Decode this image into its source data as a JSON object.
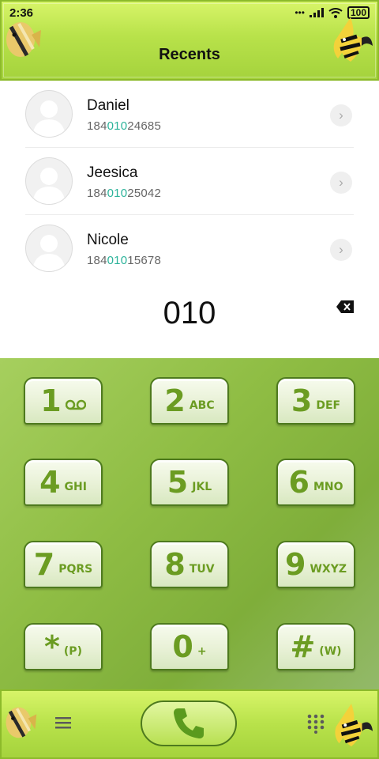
{
  "status": {
    "time": "2:36",
    "battery": "100"
  },
  "header": {
    "title": "Recents"
  },
  "contacts": [
    {
      "name": "Daniel",
      "number_prefix": "184",
      "number_match": "010",
      "number_suffix": "24685"
    },
    {
      "name": "Jeesica",
      "number_prefix": "184",
      "number_match": "010",
      "number_suffix": "25042"
    },
    {
      "name": "Nicole",
      "number_prefix": "184",
      "number_match": "010",
      "number_suffix": "15678"
    }
  ],
  "dialer": {
    "entry": "010"
  },
  "keys": [
    {
      "digit": "1",
      "letters": ""
    },
    {
      "digit": "2",
      "letters": "ABC"
    },
    {
      "digit": "3",
      "letters": "DEF"
    },
    {
      "digit": "4",
      "letters": "GHI"
    },
    {
      "digit": "5",
      "letters": "JKL"
    },
    {
      "digit": "6",
      "letters": "MNO"
    },
    {
      "digit": "7",
      "letters": "PQRS"
    },
    {
      "digit": "8",
      "letters": "TUV"
    },
    {
      "digit": "9",
      "letters": "WXYZ"
    },
    {
      "digit": "*",
      "letters": "(P)"
    },
    {
      "digit": "0",
      "letters": "+"
    },
    {
      "digit": "#",
      "letters": "(W)"
    }
  ],
  "colors": {
    "theme_green": "#a4d23c",
    "key_text": "#6b9c22",
    "match_highlight": "#2cb39a"
  }
}
